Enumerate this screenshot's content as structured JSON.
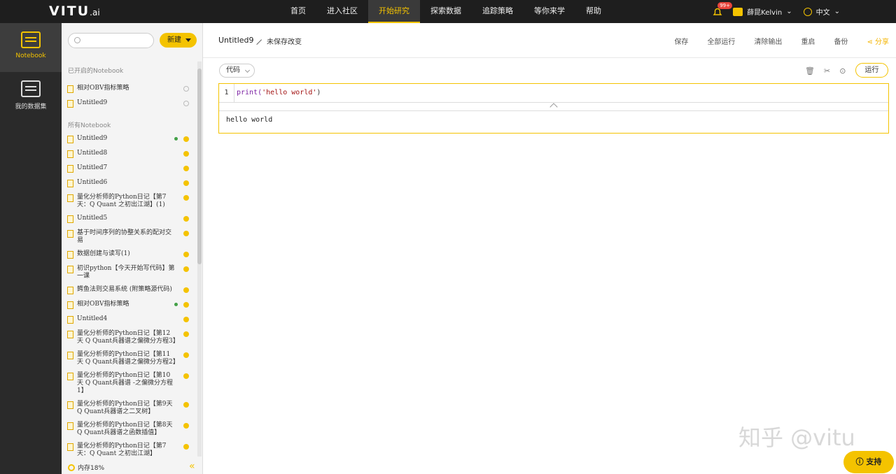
{
  "app": {
    "logo": "VITU",
    "logo_suffix": ".ai"
  },
  "nav": [
    "首页",
    "进入社区",
    "开始研究",
    "探索数据",
    "追踪策略",
    "等你来学",
    "帮助"
  ],
  "user": {
    "badge": "99+",
    "name": "薛昆Kelvin",
    "lang": "中文"
  },
  "rail": [
    {
      "label": "Notebook",
      "icon": "notebook-icon"
    },
    {
      "label": "我的数据集",
      "icon": "dataset-icon"
    }
  ],
  "panel": {
    "search_placeholder": "",
    "new_label": "新建",
    "open_label": "已开启的Notebook",
    "open_items": [
      "相对OBV指标策略",
      "Untitled9"
    ],
    "all_label": "所有Notebook",
    "items": [
      {
        "name": "Untitled9",
        "running": true
      },
      {
        "name": "Untitled8"
      },
      {
        "name": "Untitled7"
      },
      {
        "name": "Untitled6"
      },
      {
        "name": "量化分析师的Python日记【第7天：Q Quant 之初出江湖】(1)"
      },
      {
        "name": "Untitled5"
      },
      {
        "name": "基于时间序列的协整关系的配对交易"
      },
      {
        "name": "数据创建与读写(1)"
      },
      {
        "name": "初识python【今天开始写代码】第一课"
      },
      {
        "name": "鳄鱼法则交易系统 (附策略源代码)"
      },
      {
        "name": "相对OBV指标策略",
        "running": true
      },
      {
        "name": "Untitled4"
      },
      {
        "name": "量化分析师的Python日记【第12天 Q Quant兵器谱之偏微分方程3】"
      },
      {
        "name": "量化分析师的Python日记【第11天 Q Quant兵器谱之偏微分方程2】"
      },
      {
        "name": "量化分析师的Python日记【第10天 Q Quant兵器谱 -之偏微分方程1】"
      },
      {
        "name": "量化分析师的Python日记【第9天 Q Quant兵器谱之二叉树】"
      },
      {
        "name": "量化分析师的Python日记【第8天 Q Quant兵器谱之函数插值】"
      },
      {
        "name": "量化分析师的Python日记【第7天：Q Quant 之初出江湖】"
      }
    ],
    "memory": "内存18%"
  },
  "main": {
    "title": "Untitled9",
    "unsaved": "未保存改变",
    "toolbar": [
      "保存",
      "全部运行",
      "清除输出",
      "重启",
      "备份",
      "分享"
    ],
    "cell_type": "代码",
    "run_label": "运行",
    "line_number": "1",
    "code_fn": "print(",
    "code_str": "'hello world'",
    "code_end": ")",
    "output": "hello world",
    "watermark": "知乎 @vitu",
    "support": "支持"
  }
}
